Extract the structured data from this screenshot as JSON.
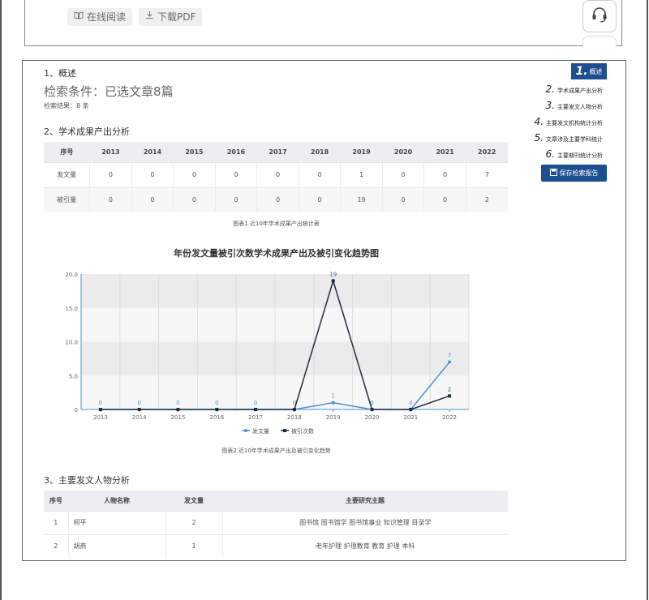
{
  "top": {
    "read_online": "在线阅读",
    "download_pdf": "下载PDF"
  },
  "report": {
    "section1": "1、概述",
    "search_condition": "检索条件：已选文章8篇",
    "search_result": "检索结果：8 条",
    "section2": "2、学术成果产出分析",
    "section3": "3、主要发文人物分析",
    "table1": {
      "headers": [
        "序号",
        "2013",
        "2014",
        "2015",
        "2016",
        "2017",
        "2018",
        "2019",
        "2020",
        "2021",
        "2022"
      ],
      "rows": [
        [
          "发文量",
          "0",
          "0",
          "0",
          "0",
          "0",
          "0",
          "1",
          "0",
          "0",
          "7"
        ],
        [
          "被引量",
          "0",
          "0",
          "0",
          "0",
          "0",
          "0",
          "19",
          "0",
          "0",
          "2"
        ]
      ]
    },
    "caption1": "图表1 近10年学术成果产出统计表",
    "caption2": "图表2 近10年学术成果产出及被引变化趋势",
    "table3": {
      "headers": [
        "序号",
        "人物名称",
        "发文量",
        "主要研究主题"
      ],
      "rows": [
        [
          "1",
          "柯平",
          "2",
          "图书馆 图书馆学 图书馆事业 知识管理 目录学"
        ],
        [
          "2",
          "胡燕",
          "1",
          "老年护理 护理教育 教育 护理 本科"
        ]
      ]
    }
  },
  "nav": {
    "items": [
      {
        "num": "1.",
        "label": "概述"
      },
      {
        "num": "2.",
        "label": "学术成果产出分析"
      },
      {
        "num": "3.",
        "label": "主要发文人物分析"
      },
      {
        "num": "4.",
        "label": "主要发文机构统计分析"
      },
      {
        "num": "5.",
        "label": "文章涉及主要学科统计"
      },
      {
        "num": "6.",
        "label": "主要期刊统计分析"
      }
    ],
    "save_label": "保存检索报告"
  },
  "colors": {
    "series1": "#4a90d9",
    "series2": "#1f2d3d",
    "nav_bg": "#1d4e8f"
  },
  "chart_data": {
    "type": "line",
    "title": "年份发文量被引次数学术成果产出及被引变化趋势图",
    "x": [
      "2013",
      "2014",
      "2015",
      "2016",
      "2017",
      "2018",
      "2019",
      "2020",
      "2021",
      "2022"
    ],
    "ylim": [
      0,
      20
    ],
    "yticks": [
      "0",
      "5.0",
      "10.0",
      "15.0",
      "20.0"
    ],
    "grid": true,
    "legend_position": "bottom-center",
    "series": [
      {
        "name": "发文量",
        "values": [
          0,
          0,
          0,
          0,
          0,
          0,
          1,
          0,
          0,
          7
        ]
      },
      {
        "name": "被引次数",
        "values": [
          0,
          0,
          0,
          0,
          0,
          0,
          19,
          0,
          0,
          2
        ]
      }
    ]
  }
}
